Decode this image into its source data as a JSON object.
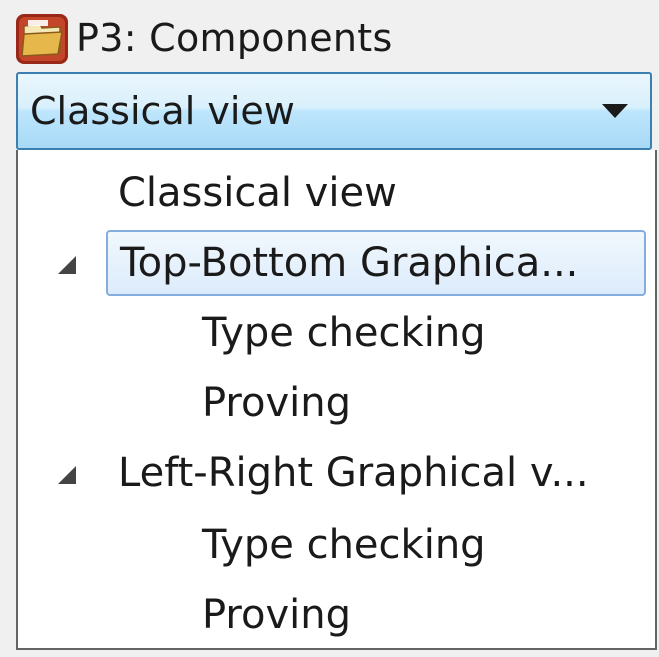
{
  "title": {
    "icon": "folder-open-icon",
    "text": "P3: Components"
  },
  "combo": {
    "selected": "Classical view",
    "arrow_icon": "dropdown-arrow-icon"
  },
  "dropdown": {
    "items": [
      {
        "label": "Classical view",
        "level": 0,
        "expandable": false,
        "selected": false
      },
      {
        "label": "Top-Bottom Graphica...",
        "level": 0,
        "expandable": true,
        "expanded": true,
        "selected": true
      },
      {
        "label": "Type checking",
        "level": 1,
        "expandable": false,
        "selected": false
      },
      {
        "label": "Proving",
        "level": 1,
        "expandable": false,
        "selected": false
      },
      {
        "label": "Left-Right Graphical v...",
        "level": 0,
        "expandable": true,
        "expanded": true,
        "selected": false
      },
      {
        "label": "Type checking",
        "level": 1,
        "expandable": false,
        "selected": false
      },
      {
        "label": "Proving",
        "level": 1,
        "expandable": false,
        "selected": false
      }
    ]
  },
  "colors": {
    "combo_border": "#3c7fb1",
    "selection_border": "#84acdd",
    "dropdown_border": "#646464"
  }
}
